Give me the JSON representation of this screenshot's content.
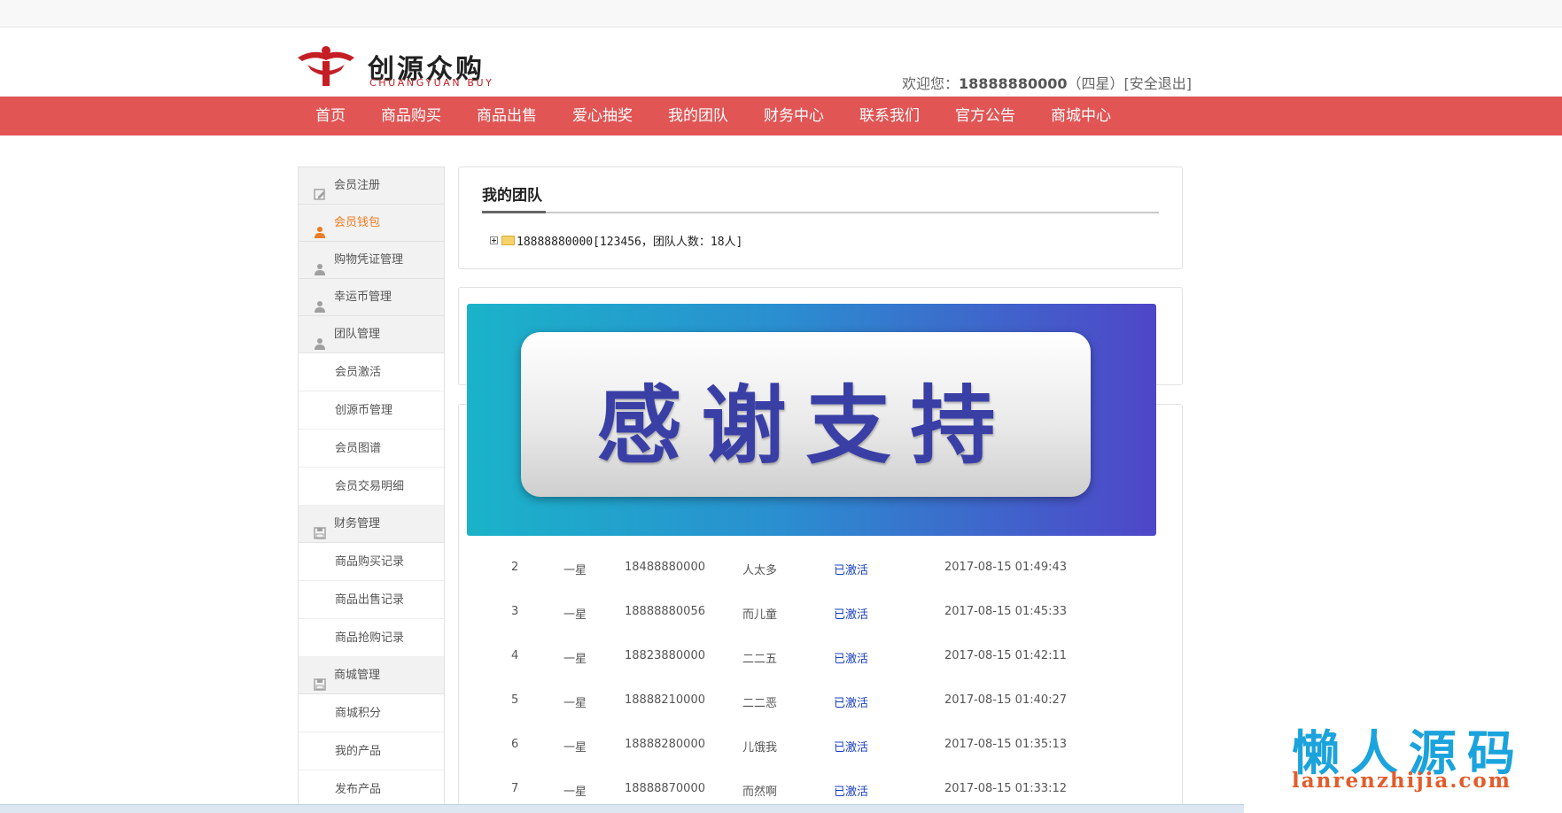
{
  "brand": {
    "name_cn": "创源众购",
    "name_en": "CHUANGYUAN BUY",
    "logo_color": "#c41e24"
  },
  "header": {
    "welcome_prefix": "欢迎您：",
    "username": "18888880000",
    "rank": "（四星）",
    "logout": "[安全退出]"
  },
  "nav": {
    "color": "#e15555",
    "items": [
      "首页",
      "商品购买",
      "商品出售",
      "爱心抽奖",
      "我的团队",
      "财务中心",
      "联系我们",
      "官方公告",
      "商城中心"
    ]
  },
  "sidebar": {
    "groups": [
      {
        "label": "会员注册",
        "icon": "edit-icon",
        "active": false
      },
      {
        "label": "会员钱包",
        "icon": "user-icon",
        "active": true
      },
      {
        "label": "购物凭证管理",
        "icon": "user-icon",
        "active": false
      },
      {
        "label": "幸运币管理",
        "icon": "user-icon",
        "active": false
      },
      {
        "label": "团队管理",
        "icon": "user-icon",
        "active": false,
        "items": [
          "会员激活",
          "创源币管理",
          "会员图谱",
          "会员交易明细"
        ]
      },
      {
        "label": "财务管理",
        "icon": "save-icon",
        "active": false,
        "items": [
          "商品购买记录",
          "商品出售记录",
          "商品抢购记录"
        ]
      },
      {
        "label": "商城管理",
        "icon": "save-icon",
        "active": false,
        "items": [
          "商城积分",
          "我的产品",
          "发布产品"
        ]
      }
    ],
    "active_color": "#ee7a1f"
  },
  "team": {
    "title": "我的团队",
    "tree_node": "18888880000[123456，团队人数：18人]"
  },
  "banner": {
    "text": "感谢支持"
  },
  "records": [
    {
      "no": "2",
      "star": "一星",
      "phone": "18488880000",
      "name": "人太多",
      "status": "已激活",
      "time": "2017-08-15 01:49:43"
    },
    {
      "no": "3",
      "star": "一星",
      "phone": "18888880056",
      "name": "而儿童",
      "status": "已激活",
      "time": "2017-08-15 01:45:33"
    },
    {
      "no": "4",
      "star": "一星",
      "phone": "18823880000",
      "name": "二二五",
      "status": "已激活",
      "time": "2017-08-15 01:42:11"
    },
    {
      "no": "5",
      "star": "一星",
      "phone": "18888210000",
      "name": "二二恶",
      "status": "已激活",
      "time": "2017-08-15 01:40:27"
    },
    {
      "no": "6",
      "star": "一星",
      "phone": "18888280000",
      "name": "儿饿我",
      "status": "已激活",
      "time": "2017-08-15 01:35:13"
    },
    {
      "no": "7",
      "star": "一星",
      "phone": "18888870000",
      "name": "而然啊",
      "status": "已激活",
      "time": "2017-08-15 01:33:12"
    }
  ],
  "watermark": {
    "cn": "懒人源码",
    "en": "lanrenzhijia.com"
  }
}
